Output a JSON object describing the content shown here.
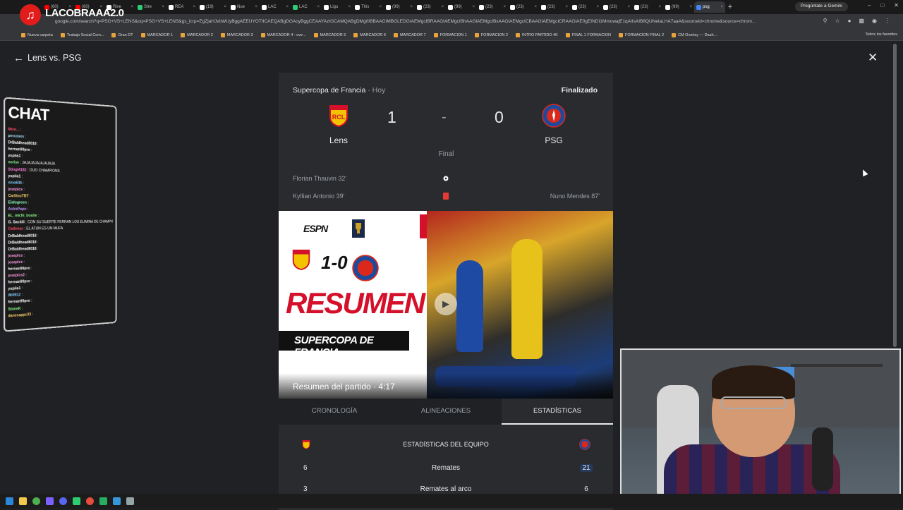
{
  "browser": {
    "tabs": [
      "(60)",
      "(60)",
      "Rive",
      "Stre",
      "REA",
      "(19)",
      "Nue",
      "LAC",
      "LAC",
      "Ligu",
      "This",
      "(99)",
      "(23)",
      "(99)",
      "(23)",
      "(23)",
      "(23)",
      "(23)",
      "(23)",
      "(23)",
      "(99)",
      "psg"
    ],
    "gemini_button": "Pregúntale a Gemini",
    "url": "google.com/search?q=PSG+VS+LENS&oq=PSG+VS+LENS&gs_lcrp=EgZjaHJvbWUyBggAEEUYOTIICAEQABgDGAoyBggCEAAYAzIGCAMQABgDMg0IBBAAGIMBGLEDGIAEMgcIBRAAGIAEMgcIBhAAGIAEMgcIBxAAGIAEMgcICBAAGIAEMgcICRAAGIAE0gEINDI1MmowajE1qAIIsAIB8QUNelaLHA7aaA&sourceid=chrome&source=chrom...",
    "bookmarks": [
      "Nueva carpeta",
      "Trabajo Social Com...",
      "Gran DT",
      "MARCADOR 1",
      "MARCADOR 2",
      "MARCADOR 3",
      "MARCADOR 4 - ove...",
      "MARCADOR 5",
      "MARCADOR 6",
      "MARCADOR 7",
      "FORMACION 1",
      "FORMACION 2",
      "INTRO PARTIDO 4K",
      "FINAL 1 FORMACION",
      "FORMACION FINAL 2",
      "CM Overlay — Dash..."
    ],
    "bookmarks_all": "Todos los favoritos"
  },
  "stream": {
    "channel": "LACOBRAAA2.0",
    "chat_title": "CHAT",
    "chat": [
      {
        "user": "Mexi...",
        "msg": ":",
        "color": "#ff4d6d"
      },
      {
        "user": "percoses",
        "msg": ":",
        "color": "#a8e0ff"
      },
      {
        "user": "DrBaldhead8018",
        "msg": ":",
        "color": "#ffffff"
      },
      {
        "user": "hernan99pro",
        "msg": ":",
        "color": "#ffffff"
      },
      {
        "user": "yupiia1",
        "msg": ":",
        "color": "#ffffff"
      },
      {
        "user": "norise",
        "msg": ": JAJAJAJAJAJAJAJA",
        "color": "#8aff8a"
      },
      {
        "user": "Stingt4182",
        "msg": ": DIJO CHAMPIONS",
        "color": "#ff7bd5"
      },
      {
        "user": "yupiia1",
        "msg": ":",
        "color": "#ffffff"
      },
      {
        "user": "nino636",
        "msg": ":",
        "color": "#7fd0ff"
      },
      {
        "user": "joseplcs",
        "msg": ":",
        "color": "#ff9de6"
      },
      {
        "user": "CarlitosTBT",
        "msg": ":",
        "color": "#ffd36b"
      },
      {
        "user": "Elalogreen",
        "msg": ":",
        "color": "#8affc1"
      },
      {
        "user": "AstraPapo",
        "msg": ":",
        "color": "#c59bff"
      },
      {
        "user": "EL_michi_bostle",
        "msg": ":",
        "color": "#8aff8a"
      },
      {
        "user": "G. Sackill",
        "msg": ": CON SU SUERTE FERRAN LOS ELIMINA DE CHAMPIONS",
        "color": "#ffffff"
      },
      {
        "user": "Cadenas",
        "msg": ": EL ATUN ES UN MUFA",
        "color": "#ff4d6d"
      },
      {
        "user": "DrBaldhead8018",
        "msg": ":",
        "color": "#ffffff"
      },
      {
        "user": "DrBaldhead8018",
        "msg": ":",
        "color": "#ffffff"
      },
      {
        "user": "DrBaldhead8018",
        "msg": ":",
        "color": "#ffffff"
      },
      {
        "user": "joseplcs",
        "msg": ":",
        "color": "#ff9de6"
      },
      {
        "user": "joseplcs",
        "msg": ":",
        "color": "#ff9de6"
      },
      {
        "user": "hernan99pro",
        "msg": ":",
        "color": "#ffffff"
      },
      {
        "user": "joseplcs2",
        "msg": ":",
        "color": "#ff9de6"
      },
      {
        "user": "hernan99pro",
        "msg": ":",
        "color": "#ffffff"
      },
      {
        "user": "yupiia1",
        "msg": ":",
        "color": "#ffffff"
      },
      {
        "user": "Will912",
        "msg": ":",
        "color": "#7fd0ff"
      },
      {
        "user": "hernan99pro",
        "msg": ":",
        "color": "#ffffff"
      },
      {
        "user": "StoneK",
        "msg": ":",
        "color": "#8aff8a"
      },
      {
        "user": "danesappc33",
        "msg": ":",
        "color": "#ffd36b"
      }
    ]
  },
  "match": {
    "page_title": "Lens vs. PSG",
    "competition": "Supercopa de Francia",
    "day": "Hoy",
    "status": "Finalizado",
    "home": {
      "name": "Lens",
      "score": "1"
    },
    "away": {
      "name": "PSG",
      "score": "0"
    },
    "dash": "-",
    "result_label": "Final",
    "events": {
      "goal_home": "Florian Thauvin 32'",
      "red_home": "Kyllian Antonio 39'",
      "red_away": "Nuno Mendes 87'"
    },
    "video": {
      "brand": "ESPN",
      "score_overlay": "1-0",
      "headline": "RESUMEN",
      "subheadline": "SUPERCOPA DE FRANCIA",
      "caption": "Resumen del partido",
      "duration": "4:17"
    },
    "tabs": [
      "CRONOLOGÍA",
      "ALINEACIONES",
      "ESTADÍSTICAS"
    ],
    "stats_header": "ESTADÍSTICAS DEL EQUIPO",
    "stats": [
      {
        "label": "Remates",
        "home": "6",
        "away": "21"
      },
      {
        "label": "Remates al arco",
        "home": "3",
        "away": "6"
      }
    ]
  },
  "colors": {
    "lens_yellow": "#f4c300",
    "lens_red": "#d4102b",
    "psg_blue": "#1d4a9c",
    "psg_red": "#da291c"
  }
}
